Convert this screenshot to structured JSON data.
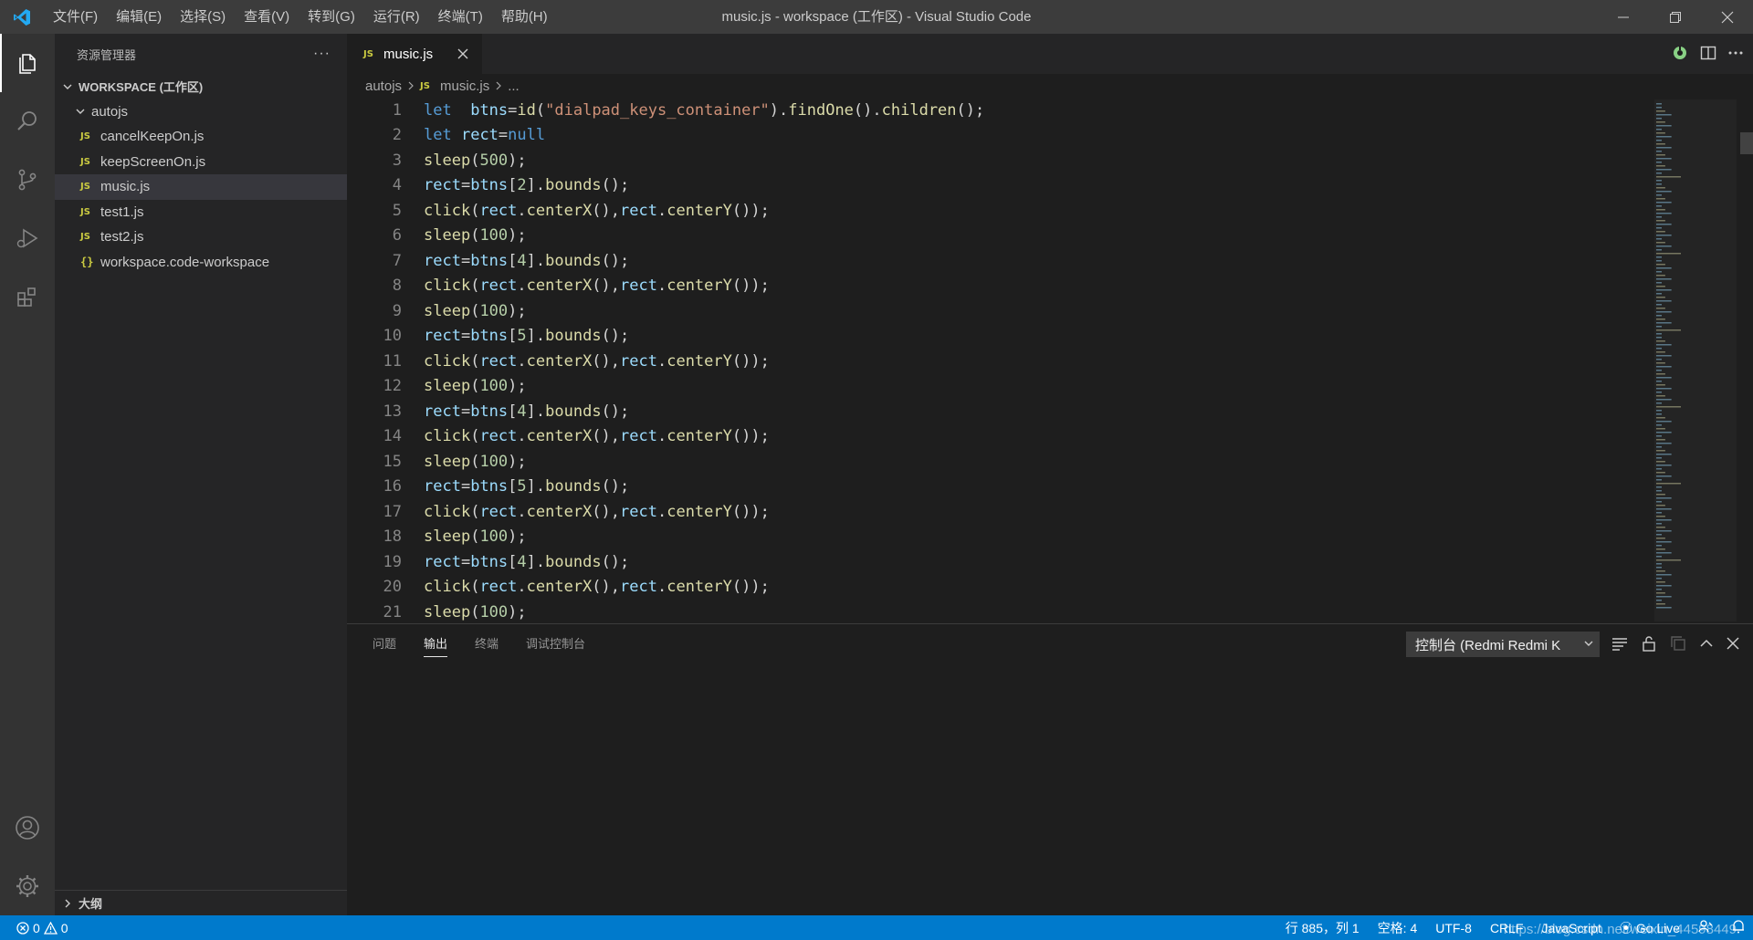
{
  "window": {
    "title": "music.js - workspace (工作区) - Visual Studio Code"
  },
  "menu": [
    "文件(F)",
    "编辑(E)",
    "选择(S)",
    "查看(V)",
    "转到(G)",
    "运行(R)",
    "终端(T)",
    "帮助(H)"
  ],
  "activity_bar": {
    "items": [
      "explorer-icon",
      "search-icon",
      "source-control-icon",
      "run-debug-icon",
      "extensions-icon"
    ],
    "bottom": [
      "account-icon",
      "gear-icon"
    ]
  },
  "sidebar": {
    "title": "资源管理器",
    "more": "···",
    "workspace_label": "WORKSPACE (工作区)",
    "folder": "autojs",
    "files": [
      {
        "badge": "JS",
        "name": "cancelKeepOn.js"
      },
      {
        "badge": "JS",
        "name": "keepScreenOn.js"
      },
      {
        "badge": "JS",
        "name": "music.js",
        "selected": true
      },
      {
        "badge": "JS",
        "name": "test1.js"
      },
      {
        "badge": "JS",
        "name": "test2.js"
      },
      {
        "badge": "{}",
        "name": "workspace.code-workspace"
      }
    ],
    "outline_label": "大纲"
  },
  "editor": {
    "tab": {
      "badge": "JS",
      "label": "music.js"
    },
    "breadcrumb": {
      "folder": "autojs",
      "badge": "JS",
      "file": "music.js",
      "tail": "..."
    },
    "lines": [
      {
        "n": "1",
        "text": "let  btns=id(\"dialpad_keys_container\").findOne().children();"
      },
      {
        "n": "2",
        "text": "let rect=null"
      },
      {
        "n": "3",
        "text": "sleep(500);"
      },
      {
        "n": "4",
        "text": "rect=btns[2].bounds();"
      },
      {
        "n": "5",
        "text": "click(rect.centerX(),rect.centerY());"
      },
      {
        "n": "6",
        "text": "sleep(100);"
      },
      {
        "n": "7",
        "text": "rect=btns[4].bounds();"
      },
      {
        "n": "8",
        "text": "click(rect.centerX(),rect.centerY());"
      },
      {
        "n": "9",
        "text": "sleep(100);"
      },
      {
        "n": "10",
        "text": "rect=btns[5].bounds();"
      },
      {
        "n": "11",
        "text": "click(rect.centerX(),rect.centerY());"
      },
      {
        "n": "12",
        "text": "sleep(100);"
      },
      {
        "n": "13",
        "text": "rect=btns[4].bounds();"
      },
      {
        "n": "14",
        "text": "click(rect.centerX(),rect.centerY());"
      },
      {
        "n": "15",
        "text": "sleep(100);"
      },
      {
        "n": "16",
        "text": "rect=btns[5].bounds();"
      },
      {
        "n": "17",
        "text": "click(rect.centerX(),rect.centerY());"
      },
      {
        "n": "18",
        "text": "sleep(100);"
      },
      {
        "n": "19",
        "text": "rect=btns[4].bounds();"
      },
      {
        "n": "20",
        "text": "click(rect.centerX(),rect.centerY());"
      },
      {
        "n": "21",
        "text": "sleep(100);"
      }
    ]
  },
  "panel": {
    "tabs": [
      "问题",
      "输出",
      "终端",
      "调试控制台"
    ],
    "active_tab": "输出",
    "output_channel": "控制台 (Redmi Redmi K"
  },
  "statusbar": {
    "errors": "0",
    "warnings": "0",
    "position": "行 885，列 1",
    "indent": "空格: 4",
    "encoding": "UTF-8",
    "eol": "CRLF",
    "language": "JavaScript",
    "golive": "Go Live",
    "watermark": "https://blog.csdn.net/weixin_44598449"
  },
  "colors": {
    "statusbar": "#007acc",
    "keyword": "#569cd6",
    "function": "#dcdcaa",
    "variable": "#9cdcfe",
    "number": "#b5cea8",
    "string": "#ce9178"
  }
}
